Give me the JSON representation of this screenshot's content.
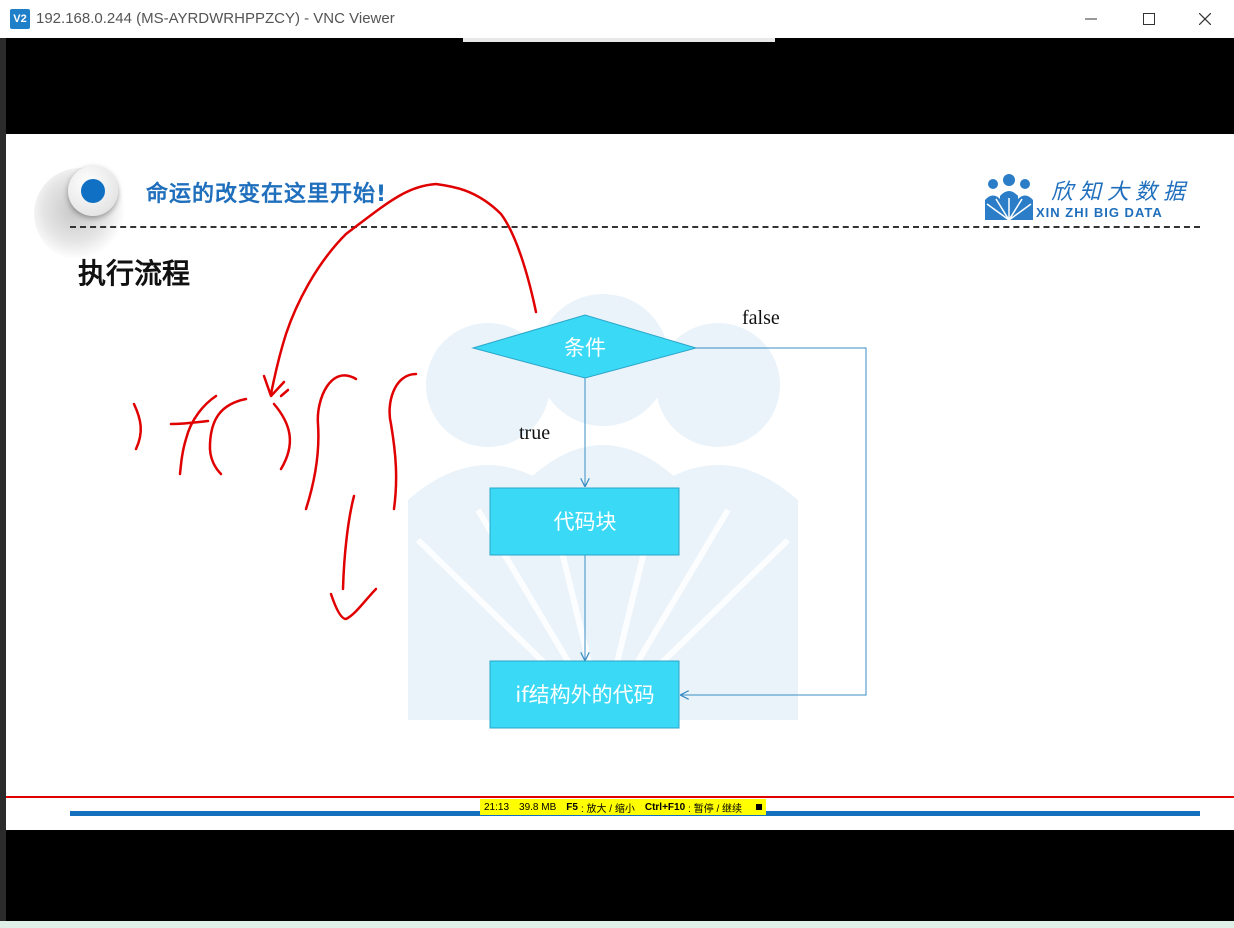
{
  "window": {
    "title": "192.168.0.244 (MS-AYRDWRHPPZCY) - VNC Viewer",
    "icon": "V2",
    "controls": [
      "minimize-icon",
      "maximize-icon",
      "close-icon"
    ]
  },
  "slide": {
    "slogan": "命运的改变在这里开始!",
    "logo_cn": "欣知大数据",
    "logo_en": "XIN ZHI BIG DATA",
    "heading": "执行流程",
    "flow": {
      "condition": "条件",
      "code_block": "代码块",
      "outside_code": "if结构外的代码",
      "true_label": "true",
      "false_label": "false"
    },
    "colors": {
      "node_fill": "#3ad9f6",
      "accent": "#1f6fbd",
      "annotation": "#e00000"
    }
  },
  "statusbar": {
    "time": "21:13",
    "memory": "39.8 MB",
    "key1": "F5",
    "action1": ": 放大 / 缩小",
    "key2": "Ctrl+F10",
    "action2": ": 暂停 / 继续"
  }
}
